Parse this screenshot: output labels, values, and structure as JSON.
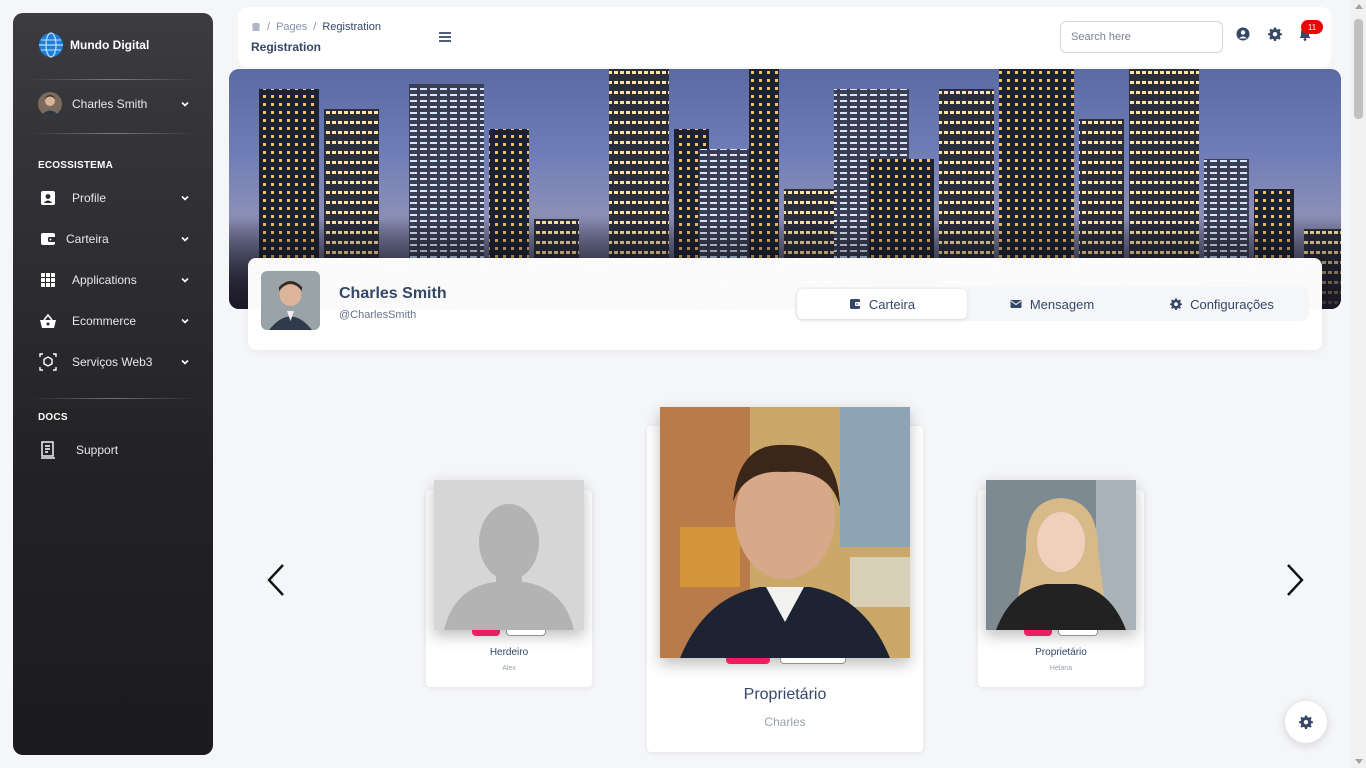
{
  "brand": {
    "name": "Mundo Digital",
    "logo_icon": "globe-icon"
  },
  "sidebar": {
    "user": {
      "name": "Charles Smith"
    },
    "section_ecosystem": "ECOSSISTEMA",
    "items": [
      {
        "label": "Profile",
        "icon": "contact-card-icon"
      },
      {
        "label": "Carteira",
        "icon": "wallet-icon"
      },
      {
        "label": "Applications",
        "icon": "apps-grid-icon"
      },
      {
        "label": "Ecommerce",
        "icon": "basket-icon"
      },
      {
        "label": "Serviços Web3",
        "icon": "web3-cube-icon"
      }
    ],
    "section_docs": "DOCS",
    "docs_items": [
      {
        "label": "Support",
        "icon": "document-icon"
      }
    ]
  },
  "topbar": {
    "breadcrumb": {
      "separator": "/",
      "parent": "Pages",
      "current": "Registration"
    },
    "title": "Registration",
    "search_placeholder": "Search here",
    "notification_count": "11"
  },
  "profile": {
    "name": "Charles Smith",
    "handle": "@CharlesSmith",
    "tabs": [
      {
        "label": "Carteira",
        "icon": "wallet-icon",
        "active": true
      },
      {
        "label": "Mensagem",
        "icon": "envelope-icon",
        "active": false
      },
      {
        "label": "Configurações",
        "icon": "gear-icon",
        "active": false
      }
    ]
  },
  "carousel": {
    "cards": [
      {
        "role": "Herdeiro",
        "name": "Alex"
      },
      {
        "role": "Proprietário",
        "name": "Charles"
      },
      {
        "role": "Proprietário",
        "name": "Helana"
      }
    ]
  },
  "colors": {
    "accent": "#e91e63",
    "badge": "#ea0606",
    "text": "#344767"
  }
}
